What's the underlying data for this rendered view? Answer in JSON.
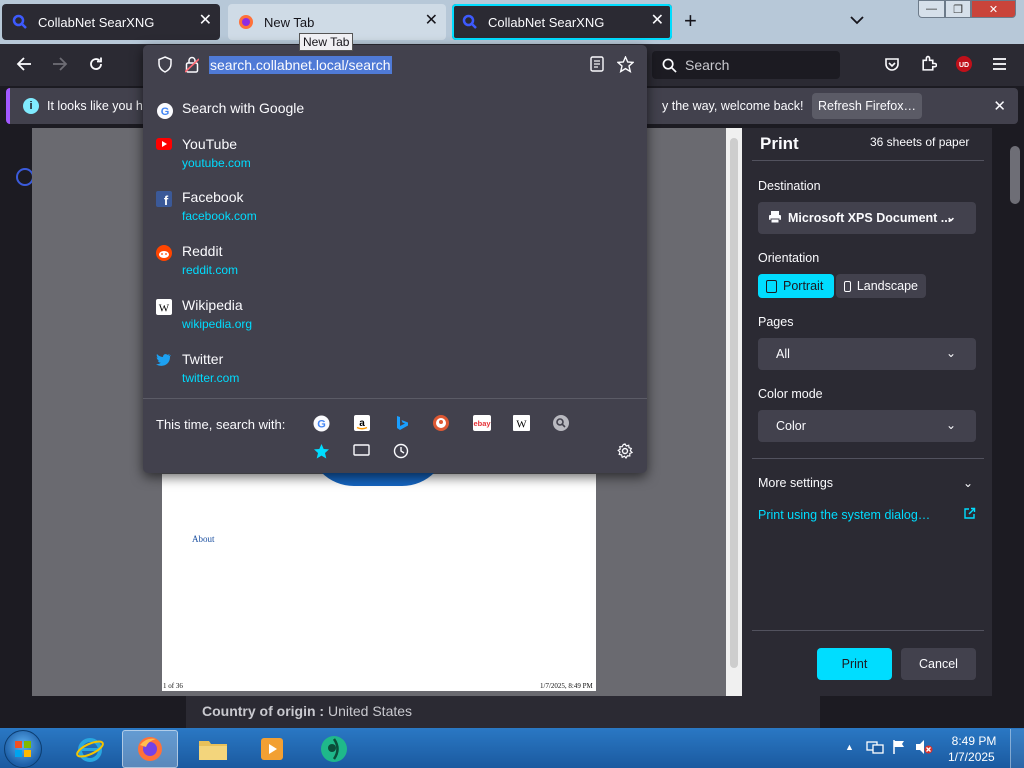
{
  "tabs": [
    {
      "title": "CollabNet SearXNG",
      "state": "normal"
    },
    {
      "title": "New Tab",
      "state": "inactive"
    },
    {
      "title": "CollabNet SearXNG",
      "state": "selected"
    }
  ],
  "tooltip": "New Tab",
  "urlbar": {
    "url": "search.collabnet.local/search"
  },
  "search_box": {
    "placeholder": "Search"
  },
  "notification": {
    "text_start": "It looks like you ha",
    "text_end": "y the way, welcome back!",
    "button": "Refresh Firefox…"
  },
  "dropdown": {
    "search_with": "Search with Google",
    "results": [
      {
        "title": "YouTube",
        "url": "youtube.com",
        "icon": "youtube-icon"
      },
      {
        "title": "Facebook",
        "url": "facebook.com",
        "icon": "facebook-icon"
      },
      {
        "title": "Reddit",
        "url": "reddit.com",
        "icon": "reddit-icon"
      },
      {
        "title": "Wikipedia",
        "url": "wikipedia.org",
        "icon": "wikipedia-icon"
      },
      {
        "title": "Twitter",
        "url": "twitter.com",
        "icon": "twitter-icon"
      }
    ],
    "this_time": "This time, search with:",
    "engines": [
      "google",
      "amazon",
      "bing",
      "duckduckgo",
      "ebay",
      "wikipedia",
      "search"
    ]
  },
  "print": {
    "title": "Print",
    "sheets": "36 sheets of paper",
    "destination_label": "Destination",
    "destination_value": "Microsoft XPS Document ...",
    "orientation_label": "Orientation",
    "portrait": "Portrait",
    "landscape": "Landscape",
    "pages_label": "Pages",
    "pages_value": "All",
    "color_label": "Color mode",
    "color_value": "Color",
    "more_settings": "More settings",
    "system_dialog": "Print using the system dialog…",
    "print_button": "Print",
    "cancel_button": "Cancel"
  },
  "preview": {
    "about": "About",
    "page_num": "1 of 36",
    "page_date": "1/7/2025, 8:49 PM"
  },
  "page": {
    "country_label": "Country of origin :",
    "country_value": "United States"
  },
  "taskbar": {
    "time": "8:49 PM",
    "date": "1/7/2025"
  },
  "colors": {
    "accent": "#00ddff",
    "panel": "#2b2a33",
    "popup": "#42414d"
  }
}
